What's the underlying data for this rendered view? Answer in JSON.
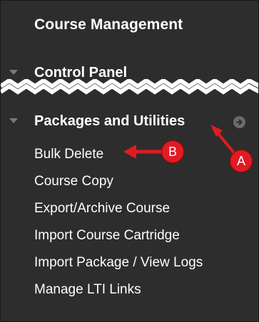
{
  "panel": {
    "heading": "Course Management",
    "control_panel": "Control Panel",
    "packages_section": "Packages and Utilities",
    "links": [
      "Bulk Delete",
      "Course Copy",
      "Export/Archive Course",
      "Import Course Cartridge",
      "Import Package / View Logs",
      "Manage LTI Links"
    ]
  },
  "annotations": {
    "a": "A",
    "b": "B"
  },
  "colors": {
    "panel_bg": "#2d2d2d",
    "text": "#ffffff",
    "annotation": "#e01b24"
  },
  "icons": {
    "collapse": "triangle-down-icon",
    "go": "circle-arrow-right-icon"
  }
}
